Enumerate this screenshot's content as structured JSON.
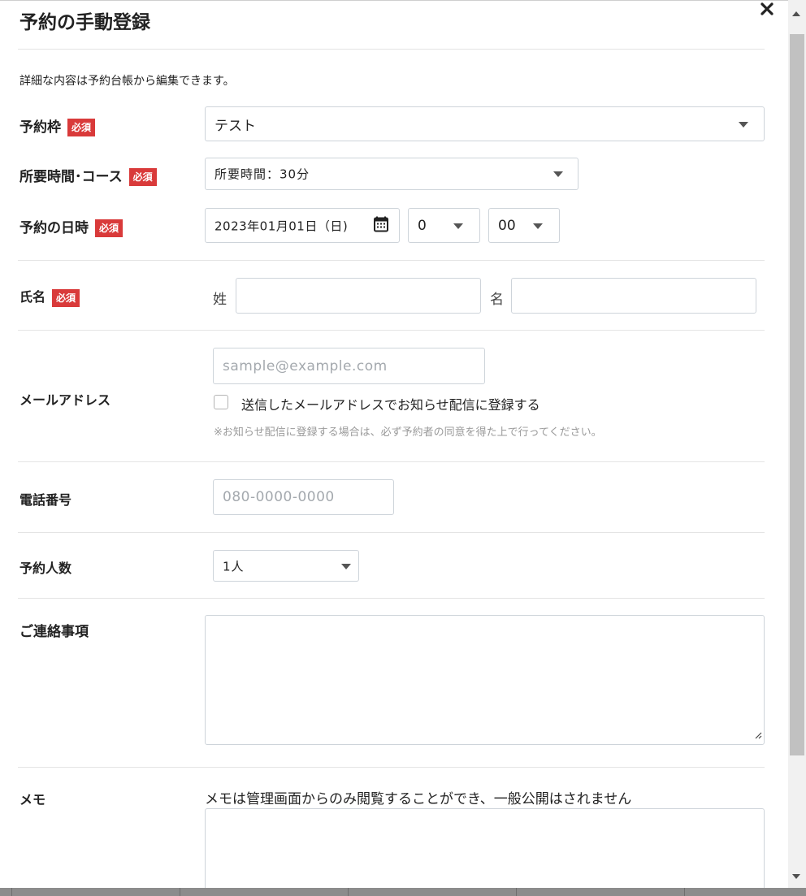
{
  "dialog": {
    "title": "予約の手動登録",
    "intro": "詳細な内容は予約台帳から編集できます。"
  },
  "required_badge": "必須",
  "fields": {
    "slot": {
      "label": "予約枠",
      "value": "テスト"
    },
    "course": {
      "label": "所要時間･コース",
      "value": "所要時間：30分"
    },
    "datetime": {
      "label": "予約の日時",
      "date": "2023年01月01日（日)",
      "hour": "0",
      "minute": "00"
    },
    "name": {
      "label": "氏名",
      "last_label": "姓",
      "first_label": "名",
      "last_value": "",
      "first_value": ""
    },
    "email": {
      "label": "メールアドレス",
      "placeholder": "sample@example.com",
      "checkbox_label": "送信したメールアドレスでお知らせ配信に登録する",
      "checkbox_checked": false,
      "note": "※お知らせ配信に登録する場合は、必ず予約者の同意を得た上で行ってください。"
    },
    "phone": {
      "label": "電話番号",
      "placeholder": "080-0000-0000"
    },
    "people": {
      "label": "予約人数",
      "value": "1人"
    },
    "message": {
      "label": "ご連絡事項",
      "value": ""
    },
    "memo": {
      "label": "メモ",
      "note": "メモは管理画面からのみ閲覧することができ、一般公開はされません",
      "value": ""
    }
  },
  "icons": {
    "close": "close-icon",
    "calendar": "calendar-icon",
    "dropdown": "chevron-down-icon"
  }
}
